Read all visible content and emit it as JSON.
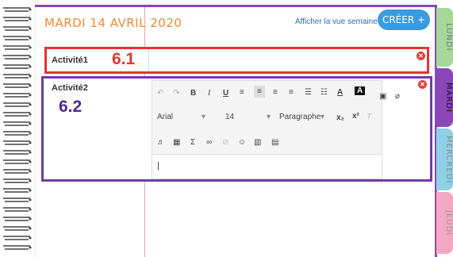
{
  "header": {
    "date_title": "MARDI 14 AVRIL 2020",
    "week_view_link": "Afficher la vue semaine",
    "create_button": "CRÉER +"
  },
  "activities": [
    {
      "label": "Activité1",
      "number": "6.1"
    },
    {
      "label": "Activité2",
      "number": "6.2"
    }
  ],
  "editor": {
    "font_family": "Arial",
    "font_size": "14",
    "paragraph_style": "Paragraphe"
  },
  "tabs": {
    "lundi": "LUNDI",
    "mardi": "MARDI",
    "mercredi": "MERCREDI",
    "jeudi": "JEUDI"
  },
  "colors": {
    "accent_purple": "#8a47b8",
    "highlight_red": "#e3342f",
    "highlight_purple": "#6b3fa0",
    "date_orange": "#f0893a",
    "create_blue": "#3b9be0",
    "tab_lundi": "#a7d89a",
    "tab_mardi": "#8a47b8",
    "tab_mercredi": "#8fd0e6",
    "tab_jeudi": "#f3a9c2"
  }
}
